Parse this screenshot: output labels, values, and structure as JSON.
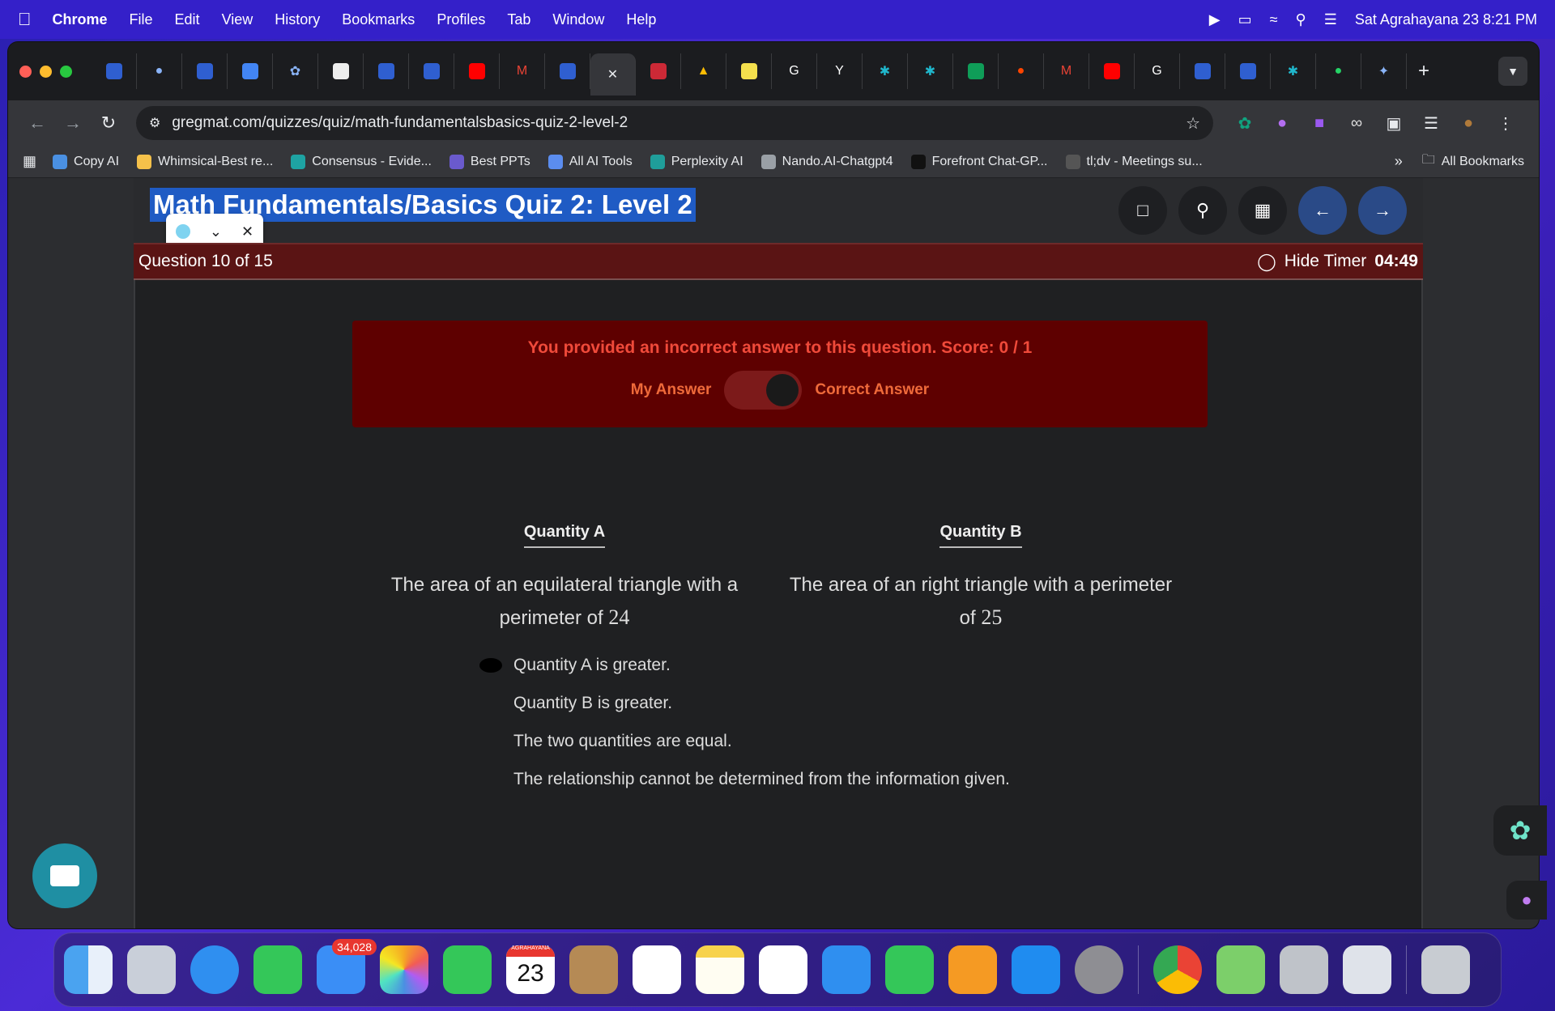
{
  "menubar": {
    "app": "Chrome",
    "items": [
      "File",
      "Edit",
      "View",
      "History",
      "Bookmarks",
      "Profiles",
      "Tab",
      "Window",
      "Help"
    ],
    "datetime": "Sat Agrahayana 23  8:21 PM"
  },
  "browser": {
    "url": "gregmat.com/quizzes/quiz/math-fundamentalsbasics-quiz-2-level-2",
    "bookmarks": [
      {
        "label": "Copy AI",
        "color": "#4a90e2"
      },
      {
        "label": "Whimsical-Best re...",
        "color": "#f5c14a"
      },
      {
        "label": "Consensus - Evide...",
        "color": "#1ea3a3"
      },
      {
        "label": "Best PPTs",
        "color": "#6a5acd"
      },
      {
        "label": "All AI Tools",
        "color": "#5b8def"
      },
      {
        "label": "Perplexity AI",
        "color": "#1f9e9a"
      },
      {
        "label": "Nando.AI-Chatgpt4",
        "color": "#9aa0a6"
      },
      {
        "label": "Forefront Chat-GP...",
        "color": "#111111"
      },
      {
        "label": "tl;dv - Meetings su...",
        "color": "#555555"
      }
    ],
    "all_bookmarks": "All Bookmarks"
  },
  "quiz": {
    "title": "Math Fundamentals/Basics Quiz 2: Level 2",
    "question_counter": "Question 10 of 15",
    "hide_timer_label": "Hide Timer",
    "timer": "04:49",
    "feedback": "You provided an incorrect answer to this question. Score: 0 / 1",
    "my_answer_label": "My Answer",
    "correct_answer_label": "Correct Answer",
    "quantity_a": {
      "heading": "Quantity A",
      "text": "The area of an equilateral triangle with a perimeter of",
      "number": "24"
    },
    "quantity_b": {
      "heading": "Quantity B",
      "text": "The area of an right triangle with a perimeter of",
      "number": "25"
    },
    "options": [
      {
        "label": "Quantity A is greater.",
        "selected": true
      },
      {
        "label": "Quantity B is greater.",
        "selected": false
      },
      {
        "label": "The two quantities are equal.",
        "selected": false
      },
      {
        "label": "The relationship cannot be determined from the information given.",
        "selected": false
      }
    ]
  },
  "dock": {
    "mail_badge": "34,028",
    "calendar_month": "AGRAHAYANA",
    "calendar_day": "23"
  },
  "colors": {
    "feedback_bg": "#5e0000",
    "feedback_text": "#f04a3a",
    "question_bar": "#5a1414",
    "title_highlight": "#1f5bc4"
  }
}
